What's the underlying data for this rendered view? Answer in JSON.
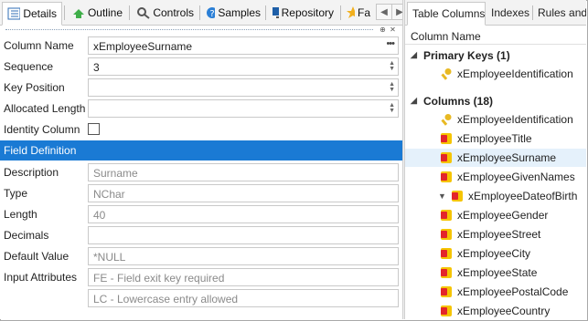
{
  "left_tabs": [
    {
      "label": "Details",
      "icon": "details-icon",
      "active": true
    },
    {
      "label": "Outline",
      "icon": "outline-icon",
      "active": false
    },
    {
      "label": "Controls",
      "icon": "controls-icon",
      "active": false
    },
    {
      "label": "Samples",
      "icon": "help-icon",
      "active": false
    },
    {
      "label": "Repository",
      "icon": "monitor-icon",
      "active": false
    },
    {
      "label": "Fa",
      "icon": "star-icon",
      "active": false
    }
  ],
  "nav": {
    "prev": "◀",
    "next": "▶"
  },
  "form": {
    "column_name": {
      "label": "Column Name",
      "value": "xEmployeeSurname"
    },
    "sequence": {
      "label": "Sequence",
      "value": "3"
    },
    "key_position": {
      "label": "Key Position",
      "value": ""
    },
    "allocated_length": {
      "label": "Allocated Length",
      "value": ""
    },
    "identity_column": {
      "label": "Identity Column",
      "checked": false
    },
    "section_title": "Field Definition",
    "description": {
      "label": "Description",
      "value": "Surname"
    },
    "type": {
      "label": "Type",
      "value": "NChar"
    },
    "length": {
      "label": "Length",
      "value": "40"
    },
    "decimals": {
      "label": "Decimals",
      "value": ""
    },
    "default_value": {
      "label": "Default Value",
      "value": "*NULL"
    },
    "input_attributes": {
      "label": "Input Attributes",
      "values": [
        "FE - Field exit key required",
        "LC - Lowercase entry allowed"
      ]
    }
  },
  "right_tabs": [
    {
      "label": "Table Columns",
      "active": true
    },
    {
      "label": "Indexes",
      "active": false
    },
    {
      "label": "Rules and T",
      "active": false
    }
  ],
  "tree": {
    "header": "Column Name",
    "primary_keys": {
      "label": "Primary Keys (1)",
      "items": [
        "xEmployeeIdentification"
      ]
    },
    "columns": {
      "label": "Columns (18)",
      "items": [
        "xEmployeeIdentification",
        "xEmployeeTitle",
        "xEmployeeSurname",
        "xEmployeeGivenNames",
        "xEmployeeDateofBirth",
        "xEmployeeGender",
        "xEmployeeStreet",
        "xEmployeeCity",
        "xEmployeeState",
        "xEmployeePostalCode",
        "xEmployeeCountry"
      ],
      "selected": "xEmployeeSurname"
    }
  },
  "colors": {
    "accent": "#1a7ad4",
    "selection": "#e5f1fb",
    "key_gold": "#e8b923",
    "column_red": "#e3242b",
    "column_yellow": "#f5c400"
  }
}
